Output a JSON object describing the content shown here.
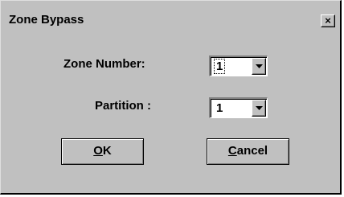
{
  "dialog": {
    "title": "Zone Bypass",
    "close_glyph": "×"
  },
  "fields": {
    "zone_number": {
      "label": "Zone Number:",
      "value": "1"
    },
    "partition": {
      "label": "Partition :",
      "value": "1"
    }
  },
  "buttons": {
    "ok": {
      "mnemonic": "O",
      "rest": "K"
    },
    "cancel": {
      "mnemonic": "C",
      "rest": "ancel"
    }
  },
  "icons": {
    "close": "close-icon",
    "dropdown": "triangle-down-icon"
  }
}
